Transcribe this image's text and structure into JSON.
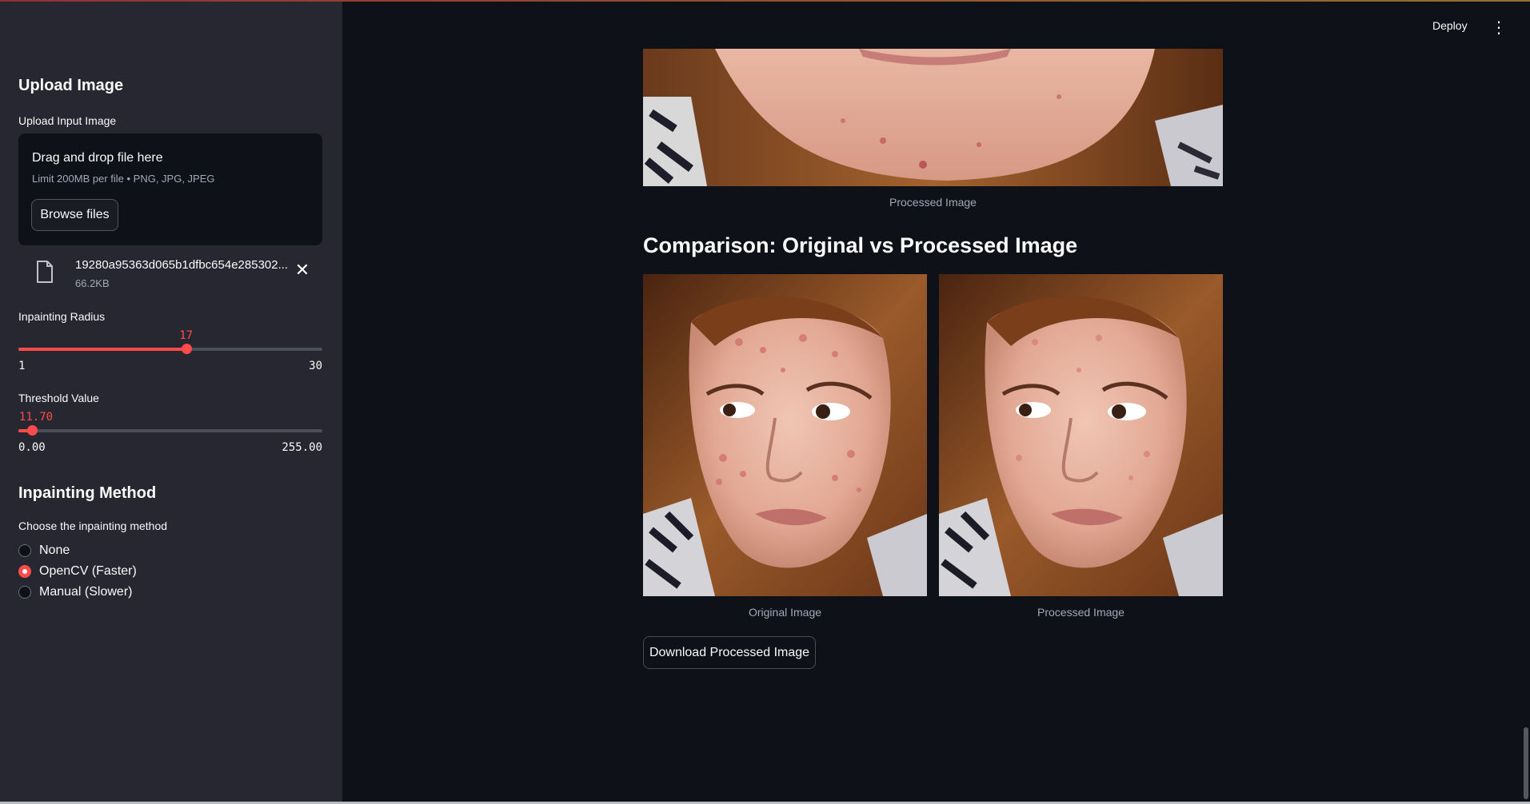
{
  "header": {
    "deploy_label": "Deploy",
    "menu_icon": "⋮"
  },
  "sidebar": {
    "upload_heading": "Upload Image",
    "upload_label": "Upload Input Image",
    "dropzone": {
      "title": "Drag and drop file here",
      "hint": "Limit 200MB per file • PNG, JPG, JPEG",
      "browse_label": "Browse files"
    },
    "file": {
      "name": "19280a95363d065b1dfbc654e285302...",
      "size": "66.2KB",
      "icon": "file-icon",
      "remove_icon": "✕"
    },
    "radius_slider": {
      "label": "Inpainting Radius",
      "value": "17",
      "min": "1",
      "max": "30",
      "value_num": 17,
      "min_num": 1,
      "max_num": 30
    },
    "threshold_slider": {
      "label": "Threshold Value",
      "value": "11.70",
      "min": "0.00",
      "max": "255.00",
      "value_num": 11.7,
      "min_num": 0,
      "max_num": 255
    },
    "method_heading": "Inpainting Method",
    "method_label": "Choose the inpainting method",
    "methods": [
      {
        "label": "None",
        "selected": false
      },
      {
        "label": "OpenCV (Faster)",
        "selected": true
      },
      {
        "label": "Manual (Slower)",
        "selected": false
      }
    ]
  },
  "main": {
    "top_caption": "Processed Image",
    "comparison_heading": "Comparison: Original vs Processed Image",
    "left_caption": "Original Image",
    "right_caption": "Processed Image",
    "download_label": "Download Processed Image"
  },
  "colors": {
    "accent": "#ff4b4b",
    "background": "#0e1117",
    "sidebar": "#262730"
  }
}
